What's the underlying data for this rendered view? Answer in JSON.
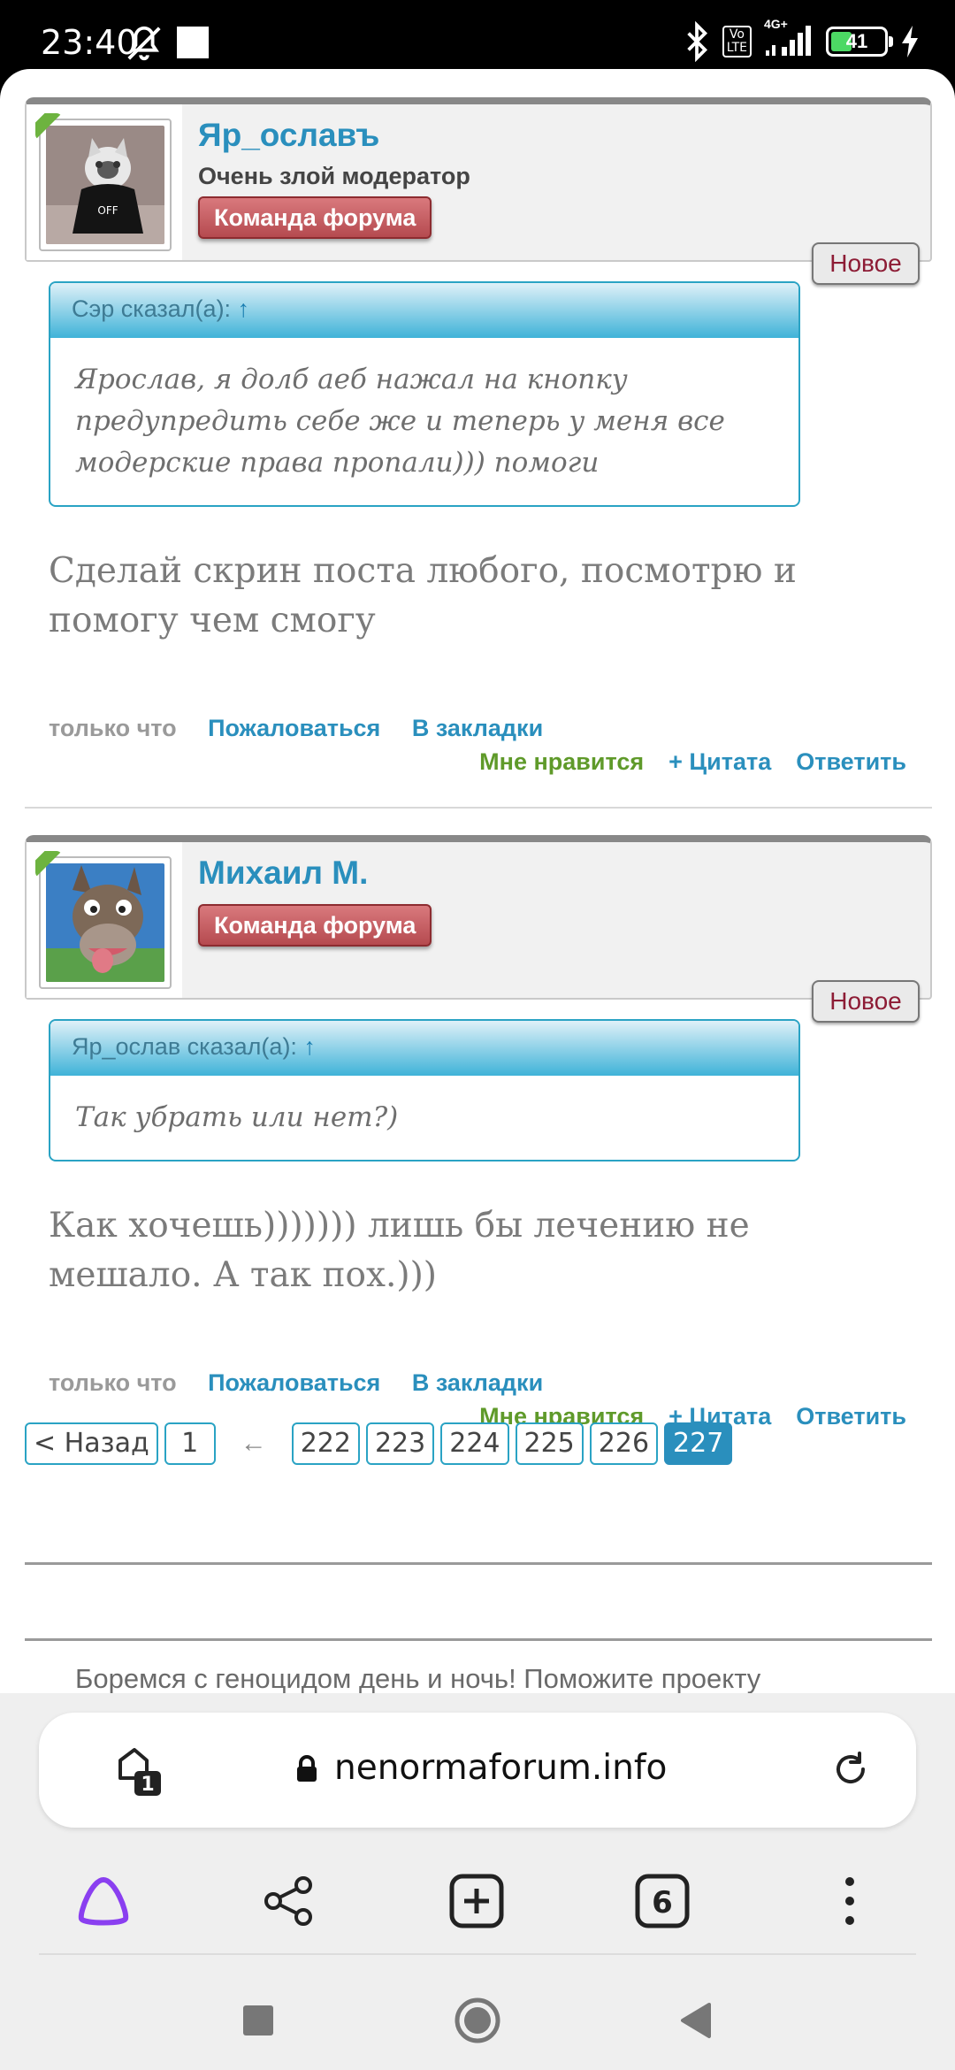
{
  "status_bar": {
    "time": "23:40",
    "network": "4G+",
    "volte_line1": "Vo",
    "volte_line2": "LTE",
    "battery": "41"
  },
  "posts": [
    {
      "username": "Яр_ославъ",
      "user_title": "Очень злой модератор",
      "badge": "Команда форума",
      "new_label": "Новое",
      "quote_author": "Сэр сказал(а):",
      "quote_arrow": "↑",
      "quote_text": "Ярослав, я долб аеб нажал на кнопку предупредить себе же и теперь у меня все модерские права пропали))) помоги",
      "message": "Сделай скрин поста любого, посмотрю и помогу чем смогу",
      "time": "только что",
      "report": "Пожаловаться",
      "bookmark": "В закладки",
      "like": "Мне нравится",
      "quote_btn": "+ Цитата",
      "reply": "Ответить"
    },
    {
      "username": "Михаил М.",
      "user_title": "",
      "badge": "Команда форума",
      "new_label": "Новое",
      "quote_author": "Яр_ослав сказал(а):",
      "quote_arrow": "↑",
      "quote_text": "Так убрать или нет?)",
      "message": "Как хочешь))))))) лишь бы лечению не мешало. А так пох.)))",
      "time": "только что",
      "report": "Пожаловаться",
      "bookmark": "В закладки",
      "like": "Мне нравится",
      "quote_btn": "+ Цитата",
      "reply": "Ответить"
    }
  ],
  "pagination": {
    "prev": "< Назад",
    "first": "1",
    "ellipsis": "←",
    "pages": [
      "222",
      "223",
      "224",
      "225",
      "226",
      "227"
    ],
    "current": "227"
  },
  "footer_text": "Боремся с геноцидом день и ночь! Поможите проекту",
  "browser": {
    "url": "nenormaforum.info",
    "tabs_badge": "1",
    "tab_count": "6"
  }
}
